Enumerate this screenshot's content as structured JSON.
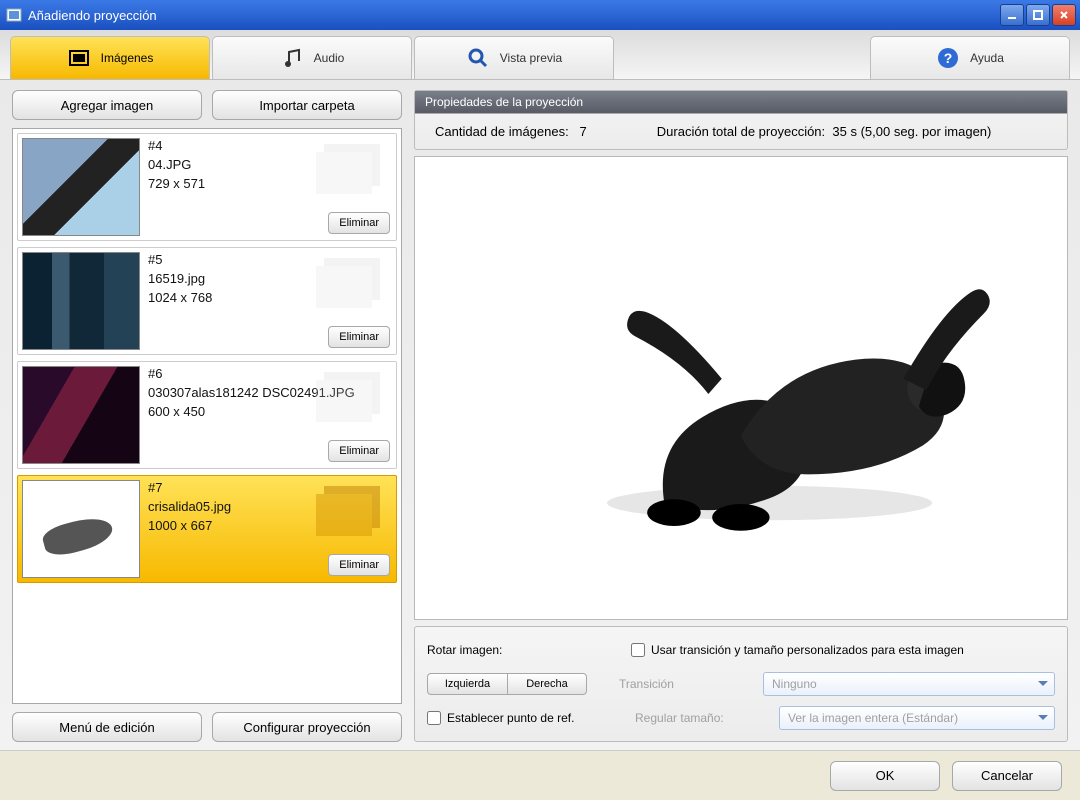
{
  "window": {
    "title": "Añadiendo proyección"
  },
  "tabs": {
    "images": "Imágenes",
    "audio": "Audio",
    "preview": "Vista previa",
    "help": "Ayuda"
  },
  "left": {
    "add_image": "Agregar imagen",
    "import_folder": "Importar carpeta",
    "edit_menu": "Menú de edición",
    "configure": "Configurar proyección",
    "delete_label": "Eliminar"
  },
  "items": [
    {
      "index": "#4",
      "filename": "04.JPG",
      "dims": "729 x 571"
    },
    {
      "index": "#5",
      "filename": "16519.jpg",
      "dims": "1024 x 768"
    },
    {
      "index": "#6",
      "filename": "030307alas181242 DSC02491.JPG",
      "dims": "600 x 450"
    },
    {
      "index": "#7",
      "filename": "crisalida05.jpg",
      "dims": "1000 x 667"
    }
  ],
  "selected_item": 3,
  "props": {
    "title": "Propiedades de la proyección",
    "count_label": "Cantidad de imágenes:",
    "count_value": "7",
    "duration_label": "Duración total de proyección:",
    "duration_value": "35 s (5,00 seg. por imagen)"
  },
  "rotate": {
    "label": "Rotar imagen:",
    "left": "Izquierda",
    "right": "Derecha",
    "set_ref": "Establecer punto de ref.",
    "use_custom": "Usar transición y tamaño personalizados para esta imagen",
    "transition_label": "Transición",
    "transition_value": "Ninguno",
    "size_label": "Regular tamaño:",
    "size_value": "Ver la imagen entera (Estándar)"
  },
  "footer": {
    "ok": "OK",
    "cancel": "Cancelar"
  }
}
